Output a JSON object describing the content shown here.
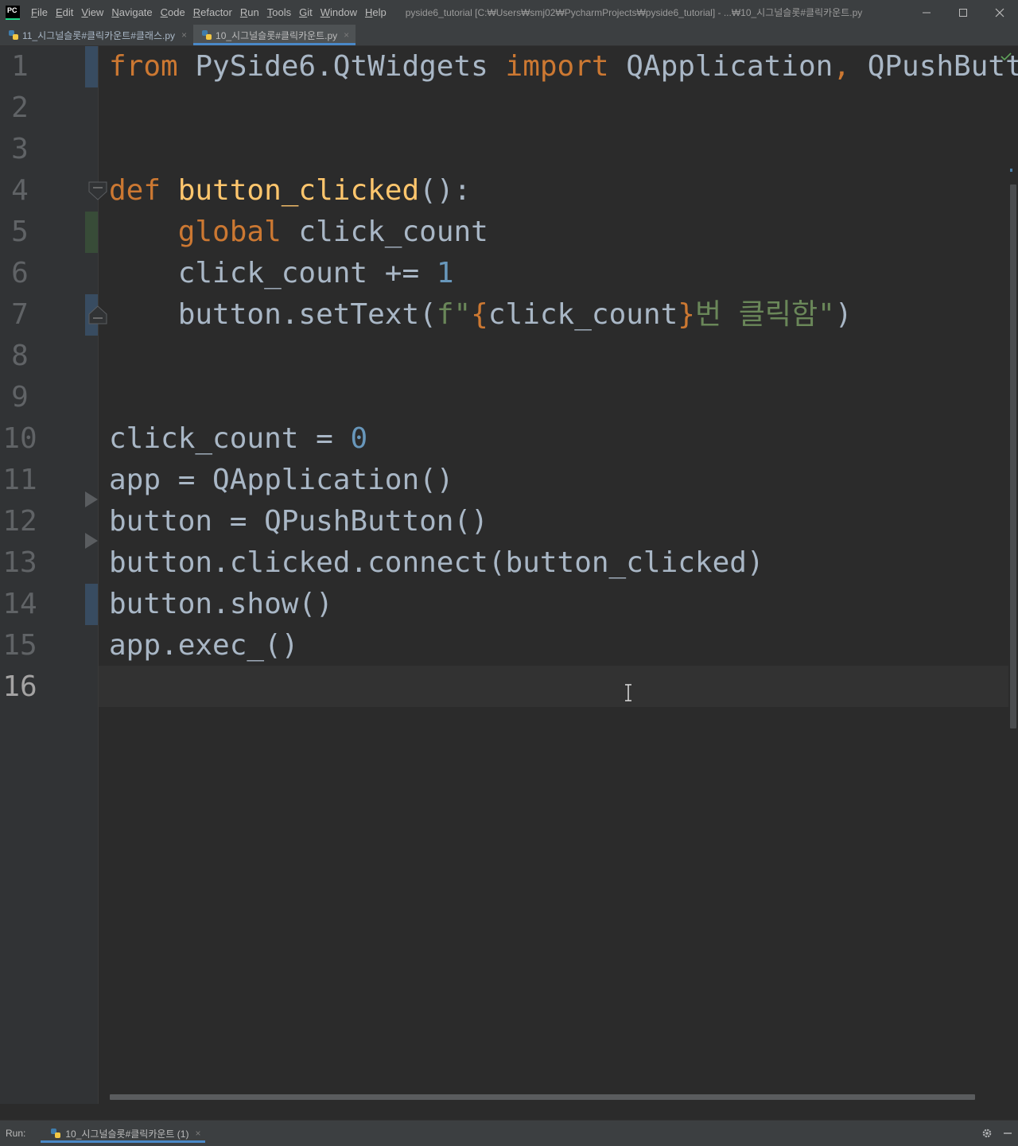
{
  "window": {
    "logo_text": "PC",
    "title": "pyside6_tutorial [C:₩Users₩smj02₩PycharmProjects₩pyside6_tutorial] - ...₩10_시그널슬롯#클릭카운트.py"
  },
  "menu": [
    "File",
    "Edit",
    "View",
    "Navigate",
    "Code",
    "Refactor",
    "Run",
    "Tools",
    "Git",
    "Window",
    "Help"
  ],
  "tabs": [
    {
      "label": "11_시그널슬롯#클릭카운트#클래스.py",
      "active": false
    },
    {
      "label": "10_시그널슬롯#클릭카운트.py",
      "active": true
    }
  ],
  "editor": {
    "current_line": 16,
    "line_numbers": [
      "1",
      "2",
      "3",
      "4",
      "5",
      "6",
      "7",
      "8",
      "9",
      "10",
      "11",
      "12",
      "13",
      "14",
      "15",
      "16"
    ],
    "code": {
      "l1": {
        "kw_from": "from",
        "module": " PySide6.QtWidgets ",
        "kw_import": "import",
        "names": " QApplication",
        "comma": ",",
        "names2": " QPushButton"
      },
      "l4": {
        "kw_def": "def",
        "fn_name": "button_clicked",
        "rest": "():"
      },
      "l5": {
        "indent": "    ",
        "kw_global": "global",
        "rest": " click_count"
      },
      "l6": {
        "text": "    click_count += ",
        "num": "1"
      },
      "l7": {
        "pre": "    button.setText(",
        "str_start": "f\"",
        "brace_open": "{",
        "expr": "click_count",
        "brace_close": "}",
        "str_text": "번 클릭함",
        "str_end": "\"",
        "close": ")"
      },
      "l10": {
        "text": "click_count = ",
        "num": "0"
      },
      "l11": {
        "text": "app = QApplication()"
      },
      "l12": {
        "text": "button = QPushButton()"
      },
      "l13": {
        "text": "button.clicked.connect(button_clicked)"
      },
      "l14": {
        "text": "button.show()"
      },
      "l15": {
        "text": "app.exec_()"
      }
    }
  },
  "run_bar": {
    "label": "Run:",
    "tab_label": "10_시그널슬롯#클릭카운트 (1)"
  },
  "colors": {
    "keyword": "#cc7832",
    "function": "#ffc66d",
    "number": "#6897bb",
    "string": "#6a8759",
    "default_text": "#a9b7c6",
    "accent": "#4a88c7"
  }
}
